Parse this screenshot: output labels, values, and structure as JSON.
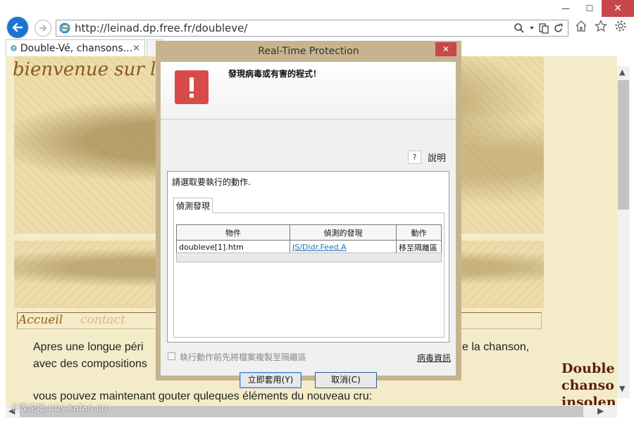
{
  "browser": {
    "address_url": "http://leinad.dp.free.fr/doubleve/",
    "tab_title": "Double-Vé, chansons...",
    "tab_close": "×",
    "window_controls": {
      "minimize": "—",
      "restore": "☐",
      "close": "✕"
    }
  },
  "page": {
    "heading": "bienvenue sur le",
    "nav": {
      "accueil": "Accueil",
      "contact": "contact"
    },
    "paragraph1_line1": "Apres une longue péri",
    "paragraph1_line1_end": "e la chanson,",
    "paragraph1_line2": "avec des compositions",
    "paragraph2": "vous pouvez maintenant gouter quleques éléments du nouveau cru:",
    "side_heading": [
      "Double",
      "chanso",
      "insolen"
    ],
    "watermark": "卡饭论坛 bbs.kafan.cn"
  },
  "dialog": {
    "title": "Real-Time Protection",
    "close": "✕",
    "message": "發現病毒或有害的程式！",
    "help_icon": "?",
    "help_label": "說明",
    "instruction": "請選取要執行的動作.",
    "tab_label": "偵測發現",
    "table": {
      "headers": [
        "物件",
        "偵測的發現",
        "動作"
      ],
      "rows": [
        {
          "object": "doubleve[1].htm",
          "detection": "JS/Dldr.Feed.A",
          "action": "移至隔離區"
        }
      ]
    },
    "checkbox_label": "執行動作前先將檔案複製至隔離區",
    "virus_info_link": "病毒資訊",
    "apply_button": "立即套用(Y)",
    "cancel_button": "取消(C)"
  },
  "colors": {
    "accent_blue": "#1e73d2",
    "close_red": "#c7474a",
    "alert_red": "#d94a4a",
    "dialog_frame": "#c5b48e",
    "page_bg": "#f4ecc8"
  }
}
